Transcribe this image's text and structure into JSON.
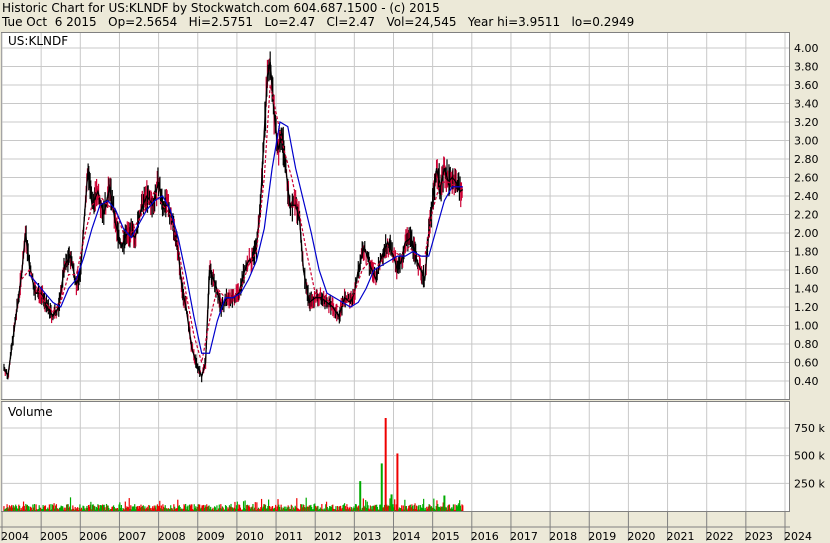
{
  "header": {
    "line1": "Historic Chart for US:KLNDF by Stockwatch.com 604.687.1500 - (c) 2015",
    "line2": "Tue Oct  6 2015   Op=2.5654   Hi=2.5751   Lo=2.47   Cl=2.47   Vol=24,545   Year hi=3.9511   lo=0.2949"
  },
  "chart_data": [
    {
      "type": "line",
      "title": "US:KLNDF",
      "y_axis_side": "right",
      "ylim": [
        0.2,
        4.1
      ],
      "y_ticks": [
        "4.00",
        "3.80",
        "3.60",
        "3.40",
        "3.20",
        "3.00",
        "2.80",
        "2.60",
        "2.40",
        "2.20",
        "2.00",
        "1.80",
        "1.60",
        "1.40",
        "1.20",
        "1.00",
        "0.80",
        "0.60",
        "0.40"
      ],
      "x_ticks": [
        "2004",
        "2005",
        "2006",
        "2007",
        "2008",
        "2009",
        "2010",
        "2011",
        "2012",
        "2013",
        "2014",
        "2015",
        "2016",
        "2017",
        "2018",
        "2019",
        "2020",
        "2021",
        "2022",
        "2023",
        "2024"
      ],
      "grid": true,
      "series": [
        {
          "color": "#000000",
          "x": [
            2004.05,
            2004.15,
            2004.5,
            2004.6,
            2004.7,
            2004.85,
            2005.0,
            2005.15,
            2005.3,
            2005.45,
            2005.6,
            2005.75,
            2005.9,
            2006.0,
            2006.1,
            2006.2,
            2006.3,
            2006.45,
            2006.6,
            2006.75,
            2006.9,
            2007.05,
            2007.2,
            2007.3,
            2007.4,
            2007.55,
            2007.7,
            2007.85,
            2008.0,
            2008.1,
            2008.25,
            2008.4,
            2008.5,
            2008.6,
            2008.7,
            2008.85,
            2009.0,
            2009.1,
            2009.2,
            2009.3,
            2009.45,
            2009.6,
            2009.75,
            2009.9,
            2010.05,
            2010.2,
            2010.3,
            2010.4,
            2010.5,
            2010.6,
            2010.7,
            2010.78,
            2010.85,
            2010.95,
            2011.05,
            2011.15,
            2011.25,
            2011.35,
            2011.5,
            2011.6,
            2011.7,
            2011.85,
            2012.0,
            2012.15,
            2012.3,
            2012.45,
            2012.6,
            2012.75,
            2012.9,
            2013.0,
            2013.1,
            2013.25,
            2013.4,
            2013.55,
            2013.7,
            2013.85,
            2014.0,
            2014.1,
            2014.2,
            2014.3,
            2014.45,
            2014.6,
            2014.7,
            2014.8,
            2014.9,
            2015.0,
            2015.1,
            2015.2,
            2015.3,
            2015.4,
            2015.5,
            2015.6,
            2015.7,
            2015.77
          ],
          "values": [
            0.55,
            0.45,
            1.55,
            2.0,
            1.65,
            1.35,
            1.35,
            1.2,
            1.1,
            1.2,
            1.65,
            1.75,
            1.45,
            1.55,
            2.15,
            2.7,
            2.3,
            2.45,
            2.2,
            2.5,
            2.1,
            1.85,
            2.0,
            2.0,
            1.95,
            2.25,
            2.4,
            2.3,
            2.55,
            2.3,
            2.3,
            2.05,
            1.8,
            1.4,
            1.2,
            0.75,
            0.55,
            0.45,
            0.6,
            1.6,
            1.45,
            1.2,
            1.3,
            1.3,
            1.35,
            1.6,
            1.7,
            1.7,
            1.85,
            2.3,
            3.1,
            3.7,
            3.85,
            3.3,
            2.9,
            3.05,
            2.7,
            2.3,
            2.3,
            2.15,
            1.6,
            1.25,
            1.3,
            1.3,
            1.25,
            1.2,
            1.1,
            1.3,
            1.25,
            1.35,
            1.6,
            1.85,
            1.65,
            1.5,
            1.75,
            1.9,
            1.75,
            1.6,
            1.7,
            1.9,
            1.95,
            1.7,
            1.6,
            1.5,
            2.0,
            2.35,
            2.7,
            2.5,
            2.7,
            2.55,
            2.6,
            2.55,
            2.45,
            2.47
          ]
        },
        {
          "color": "#cc0033",
          "x": [
            2004.5,
            2004.7,
            2004.9,
            2005.1,
            2005.3,
            2005.5,
            2005.7,
            2005.9,
            2006.1,
            2006.3,
            2006.5,
            2006.7,
            2006.9,
            2007.1,
            2007.3,
            2007.5,
            2007.7,
            2007.9,
            2008.1,
            2008.3,
            2008.5,
            2008.7,
            2008.9,
            2009.1,
            2009.3,
            2009.5,
            2009.7,
            2009.9,
            2010.1,
            2010.3,
            2010.5,
            2010.7,
            2010.85,
            2011.0,
            2011.2,
            2011.4,
            2011.6,
            2011.8,
            2012.0,
            2012.2,
            2012.4,
            2012.6,
            2012.8,
            2013.0,
            2013.2,
            2013.4,
            2013.6,
            2013.8,
            2014.0,
            2014.2,
            2014.4,
            2014.6,
            2014.8,
            2015.0,
            2015.2,
            2015.4,
            2015.6,
            2015.75
          ],
          "values": [
            1.5,
            1.6,
            1.4,
            1.25,
            1.15,
            1.25,
            1.55,
            1.55,
            1.95,
            2.3,
            2.4,
            2.3,
            2.25,
            2.0,
            2.0,
            2.15,
            2.3,
            2.45,
            2.3,
            2.2,
            1.85,
            1.35,
            0.9,
            0.6,
            1.05,
            1.4,
            1.3,
            1.3,
            1.4,
            1.65,
            1.8,
            2.6,
            3.6,
            3.3,
            2.9,
            2.6,
            2.2,
            1.75,
            1.35,
            1.3,
            1.25,
            1.2,
            1.25,
            1.35,
            1.6,
            1.7,
            1.65,
            1.75,
            1.8,
            1.75,
            1.85,
            1.75,
            1.75,
            2.25,
            2.55,
            2.55,
            2.5,
            2.5
          ]
        },
        {
          "color": "#0000cc",
          "x": [
            2004.7,
            2004.9,
            2005.1,
            2005.3,
            2005.5,
            2005.7,
            2005.9,
            2006.1,
            2006.3,
            2006.5,
            2006.7,
            2006.9,
            2007.1,
            2007.3,
            2007.5,
            2007.7,
            2007.9,
            2008.1,
            2008.3,
            2008.5,
            2008.7,
            2008.9,
            2009.1,
            2009.3,
            2009.5,
            2009.7,
            2009.9,
            2010.1,
            2010.3,
            2010.5,
            2010.7,
            2010.9,
            2011.1,
            2011.3,
            2011.5,
            2011.7,
            2011.9,
            2012.1,
            2012.3,
            2012.5,
            2012.7,
            2012.9,
            2013.1,
            2013.3,
            2013.5,
            2013.7,
            2013.9,
            2014.1,
            2014.3,
            2014.5,
            2014.7,
            2014.9,
            2015.1,
            2015.3,
            2015.5,
            2015.7,
            2015.77
          ],
          "values": [
            1.55,
            1.45,
            1.35,
            1.25,
            1.2,
            1.4,
            1.5,
            1.75,
            2.05,
            2.3,
            2.35,
            2.25,
            2.05,
            1.95,
            2.1,
            2.25,
            2.35,
            2.4,
            2.25,
            1.95,
            1.55,
            1.1,
            0.7,
            0.7,
            1.05,
            1.3,
            1.3,
            1.35,
            1.5,
            1.7,
            2.05,
            2.7,
            3.2,
            3.15,
            2.7,
            2.35,
            2.0,
            1.6,
            1.35,
            1.3,
            1.25,
            1.2,
            1.25,
            1.4,
            1.6,
            1.65,
            1.7,
            1.75,
            1.75,
            1.8,
            1.75,
            1.75,
            2.05,
            2.35,
            2.5,
            2.5,
            2.5
          ]
        }
      ]
    },
    {
      "type": "bar",
      "title": "Volume",
      "y_ticks": [
        "750 k",
        "500 k",
        "250 k"
      ],
      "ylim": [
        0,
        1000000
      ],
      "bar_colors": {
        "up": "#00aa00",
        "down": "#ee0000"
      },
      "highlights": [
        {
          "x": 2013.8,
          "value": 840000,
          "color": "#ee0000"
        },
        {
          "x": 2013.7,
          "value": 430000,
          "color": "#00aa00"
        },
        {
          "x": 2014.1,
          "value": 520000,
          "color": "#ee0000"
        },
        {
          "x": 2013.15,
          "value": 270000,
          "color": "#00aa00"
        },
        {
          "x": 2013.95,
          "value": 150000,
          "color": "#00aa00"
        },
        {
          "x": 2015.3,
          "value": 140000,
          "color": "#00aa00"
        }
      ],
      "baseline_range": [
        2004.0,
        2015.77
      ],
      "baseline_volume": 40000
    }
  ]
}
